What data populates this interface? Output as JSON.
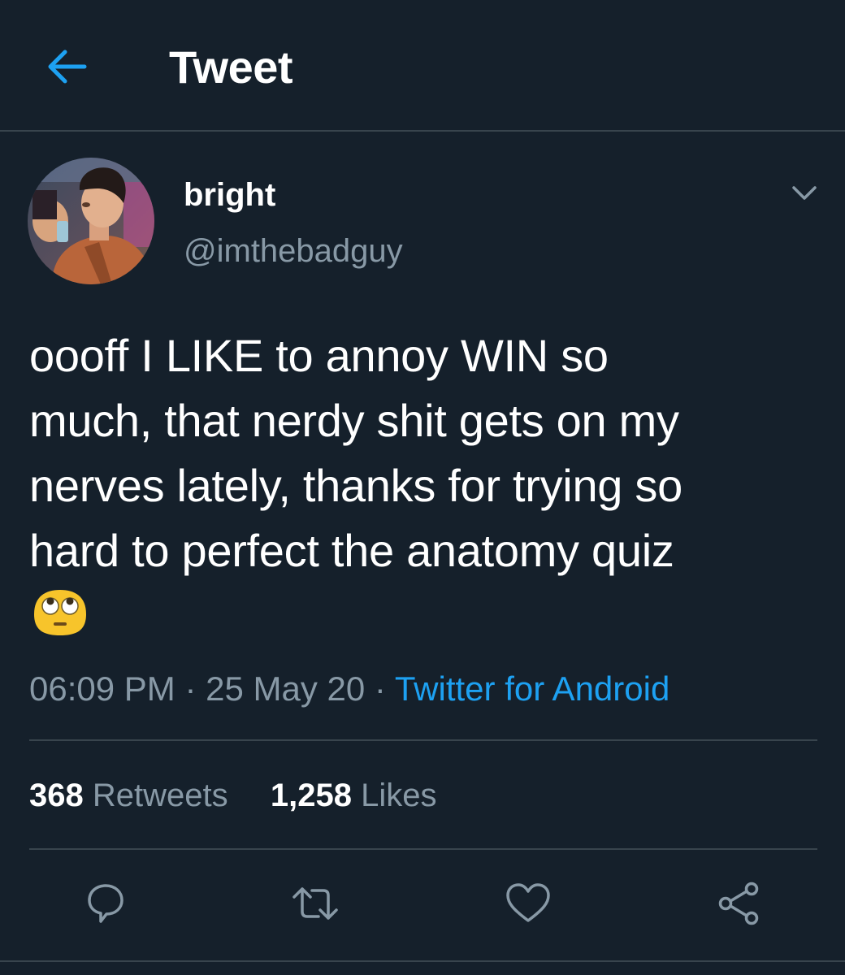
{
  "header": {
    "title": "Tweet"
  },
  "author": {
    "display_name": "bright",
    "handle": "@imthebadguy"
  },
  "tweet": {
    "text": "oooff I LIKE to annoy WIN so\nmuch, that nerdy shit gets on my\nnerves lately, thanks for trying so\nhard to perfect the anatomy quiz",
    "emoji": "face-with-rolling-eyes"
  },
  "meta": {
    "time": "06:09 PM",
    "date": "25 May 20",
    "separator": "·",
    "source": "Twitter for Android"
  },
  "stats": {
    "retweets_count": "368",
    "retweets_label": "Retweets",
    "likes_count": "1,258",
    "likes_label": "Likes"
  },
  "icons": {
    "back": "arrow-left-icon",
    "more": "chevron-down-icon",
    "reply": "reply-icon",
    "retweet": "retweet-icon",
    "like": "heart-icon",
    "share": "share-icon"
  },
  "colors": {
    "background": "#15202b",
    "accent": "#1da1f2",
    "secondary_text": "#8899a6",
    "divider": "#38444d"
  }
}
